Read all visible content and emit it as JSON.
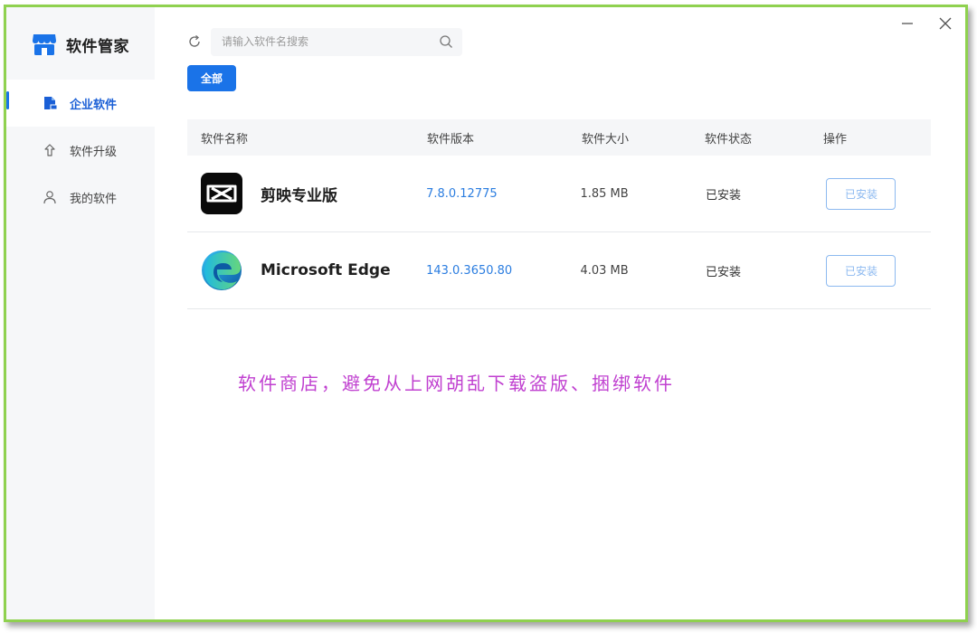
{
  "app": {
    "title": "软件管家"
  },
  "sidebar": {
    "items": [
      {
        "label": "企业软件",
        "icon": "enterprise-folder-icon",
        "active": true
      },
      {
        "label": "软件升级",
        "icon": "arrow-up-icon",
        "active": false
      },
      {
        "label": "我的软件",
        "icon": "user-icon",
        "active": false
      }
    ]
  },
  "search": {
    "placeholder": "请输入软件名搜索",
    "value": ""
  },
  "tabs": {
    "all_label": "全部"
  },
  "table": {
    "headers": {
      "name": "软件名称",
      "version": "软件版本",
      "size": "软件大小",
      "status": "软件状态",
      "action": "操作"
    },
    "rows": [
      {
        "name": "剪映专业版",
        "version": "7.8.0.12775",
        "size": "1.85 MB",
        "status": "已安装",
        "action": "已安装",
        "icon": "capcut-icon"
      },
      {
        "name": "Microsoft Edge",
        "version": "143.0.3650.80",
        "size": "4.03 MB",
        "status": "已安装",
        "action": "已安装",
        "icon": "edge-icon"
      }
    ]
  },
  "annotation": "软件商店，避免从上网胡乱下载盗版、捆绑软件",
  "colors": {
    "accent": "#1a73e8",
    "frame_border": "#8fd14f",
    "annotation": "#c040d0",
    "version_link": "#2b7de0"
  }
}
